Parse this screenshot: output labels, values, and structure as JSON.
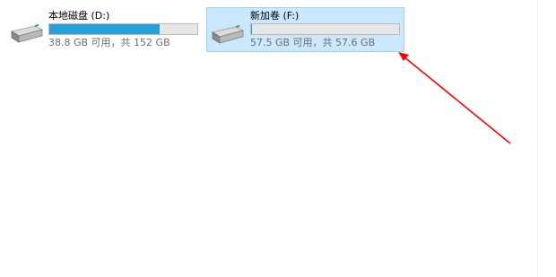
{
  "drives": [
    {
      "label": "本地磁盘 (D:)",
      "space": "38.8 GB 可用，共 152 GB",
      "used_fraction": 0.745,
      "selected": false,
      "icon": "hard-drive-icon"
    },
    {
      "label": "新加卷 (F:)",
      "space": "57.5 GB 可用，共 57.6 GB",
      "used_fraction": 0.002,
      "selected": true,
      "icon": "hard-drive-icon"
    }
  ],
  "colors": {
    "selection_bg": "#cce8ff",
    "selection_border": "#99d1ff",
    "usage_fill": "#26a0da",
    "bar_track": "#e6e6e6",
    "annotation_arrow": "#ff0000"
  }
}
